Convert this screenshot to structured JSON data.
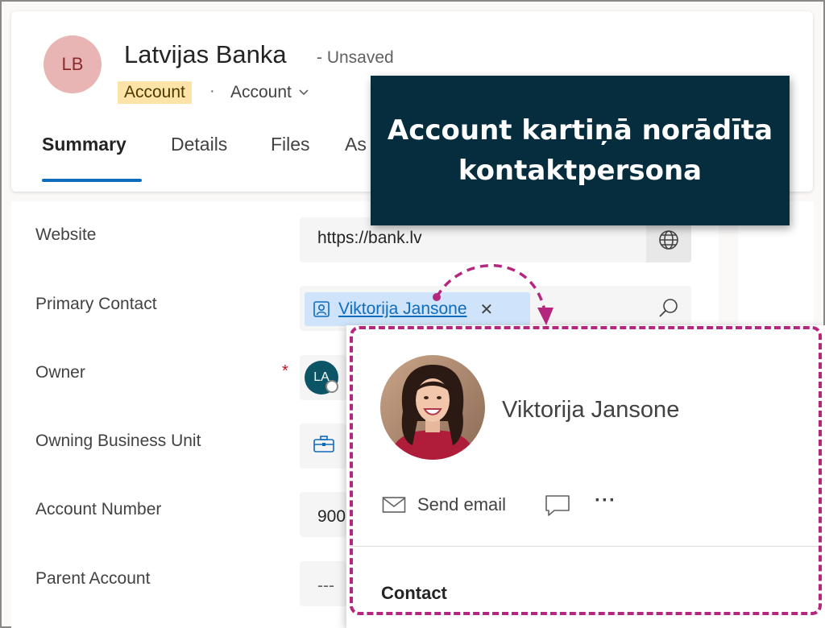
{
  "header": {
    "avatar_initials": "LB",
    "title": "Latvijas Banka",
    "save_status": "- Unsaved",
    "entity_badge": "Account",
    "separator": "·",
    "form_name": "Account",
    "tabs": [
      {
        "label": "Summary",
        "selected": true
      },
      {
        "label": "Details",
        "selected": false
      },
      {
        "label": "Files",
        "selected": false
      },
      {
        "label": "As",
        "selected": false
      }
    ]
  },
  "form": {
    "website": {
      "label": "Website",
      "value": "https://bank.lv"
    },
    "primary_contact": {
      "label": "Primary Contact",
      "value": "Viktorija Jansone"
    },
    "owner": {
      "label": "Owner",
      "required_marker": "*",
      "avatar_initials": "LA"
    },
    "owning_business_unit": {
      "label": "Owning Business Unit"
    },
    "account_number": {
      "label": "Account Number",
      "value": "900"
    },
    "parent_account": {
      "label": "Parent Account",
      "value": "---"
    }
  },
  "callout": {
    "text": "Account kartiņā norādīta kontaktpersona"
  },
  "contact_card": {
    "name": "Viktorija Jansone",
    "send_email_label": "Send email",
    "more_label": "···",
    "section_heading": "Contact"
  },
  "colors": {
    "accent": "#0f6cbd",
    "highlight": "#b5267f",
    "callout_bg": "#062d3d",
    "badge_bg": "#fde3a7",
    "required": "#c50f1f"
  }
}
